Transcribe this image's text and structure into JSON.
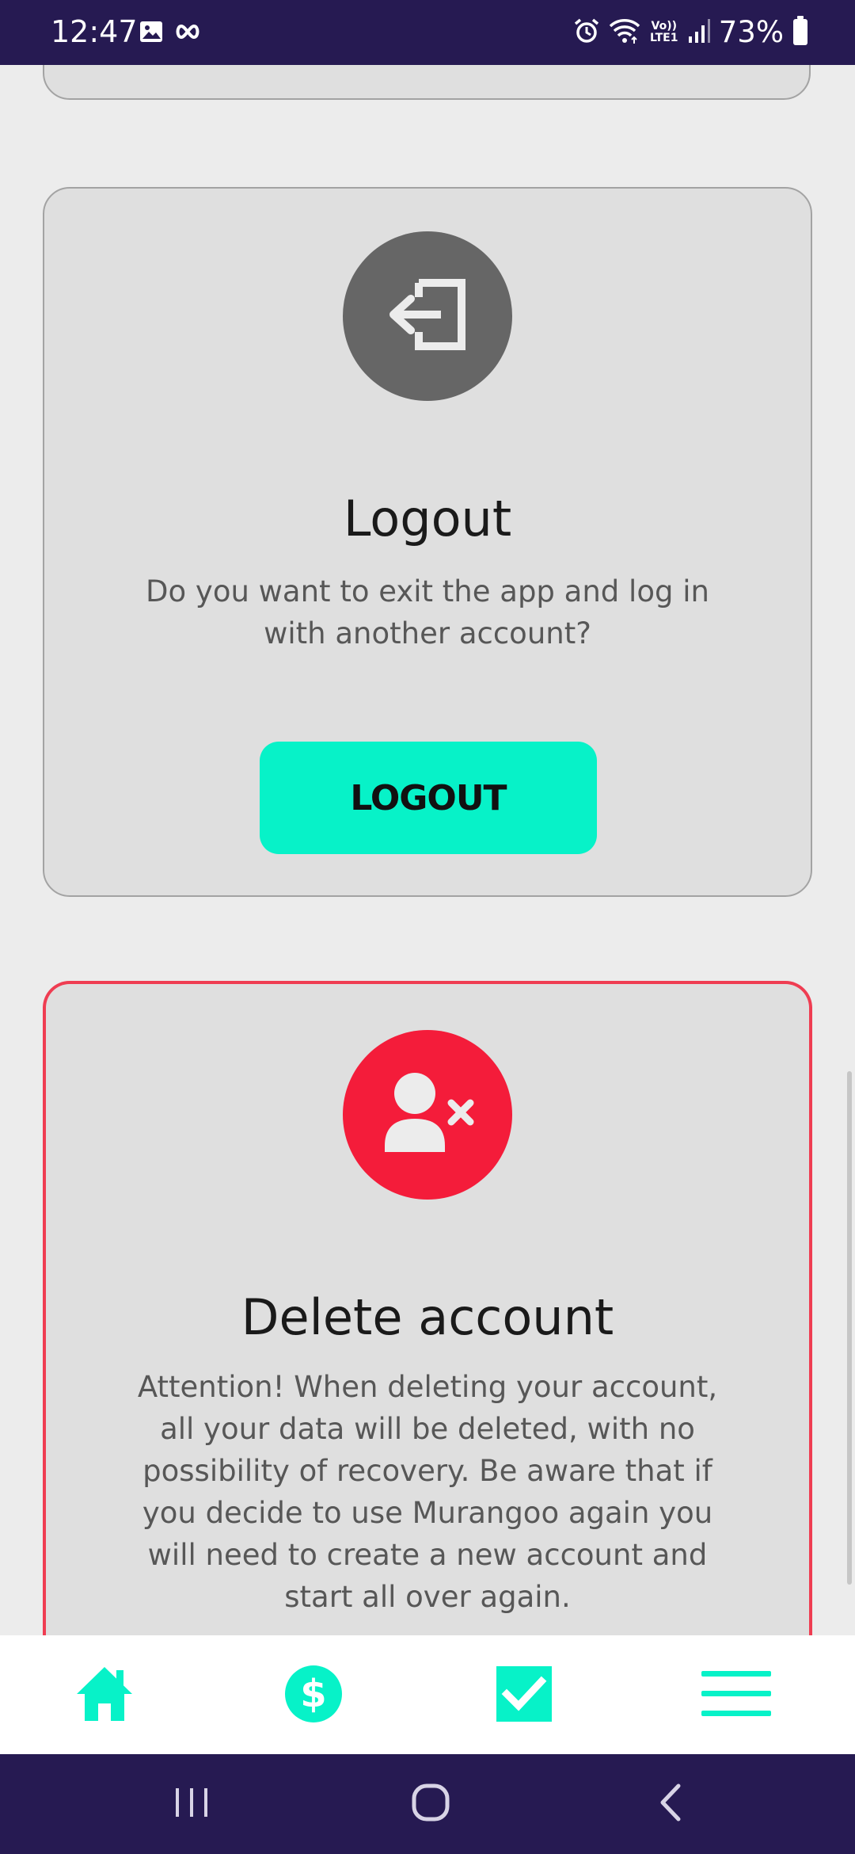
{
  "status_bar": {
    "time": "12:47",
    "volte_line1": "Vo))",
    "volte_line2": "LTE1",
    "battery_percent": "73%",
    "battery_level": 0.73,
    "icons": [
      "image-icon",
      "infinity-icon",
      "alarm-icon",
      "wifi-icon",
      "signal-icon",
      "battery-icon"
    ]
  },
  "logout_card": {
    "icon": "logout-icon",
    "title": "Logout",
    "description": "Do you want to exit the app and log in with another account?",
    "button_label": "LOGOUT"
  },
  "delete_card": {
    "icon": "user-remove-icon",
    "title": "Delete account",
    "description": "Attention! When deleting your account, all your data will be deleted, with no possibility of recovery. Be aware that if you decide to use Murangoo again you will need to create a new account and start all over again."
  },
  "bottom_nav": {
    "items": [
      {
        "icon": "home-icon"
      },
      {
        "icon": "dollar-icon"
      },
      {
        "icon": "checkbox-icon"
      },
      {
        "icon": "menu-icon"
      }
    ]
  },
  "system_nav": {
    "items": [
      "recents-icon",
      "home-circle-icon",
      "back-icon"
    ]
  },
  "colors": {
    "status_bar_bg": "#261a52",
    "accent": "#07f2c8",
    "danger": "#f41c3a",
    "card_bg": "#dfdfdf",
    "page_bg": "#ececec"
  }
}
